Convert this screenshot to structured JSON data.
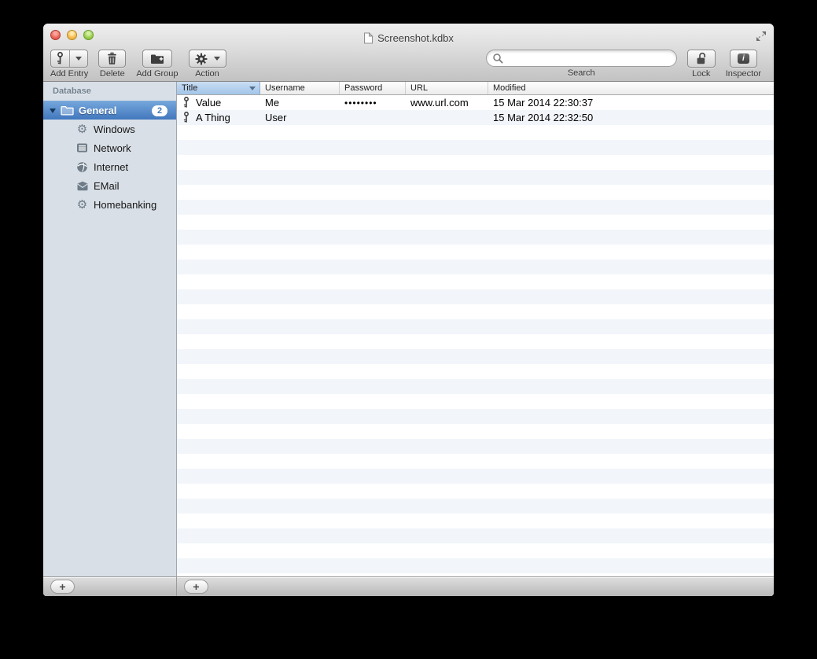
{
  "window": {
    "title": "Screenshot.kdbx"
  },
  "toolbar": {
    "add_entry_label": "Add Entry",
    "delete_label": "Delete",
    "add_group_label": "Add Group",
    "action_label": "Action",
    "search_label": "Search",
    "search_value": "",
    "lock_label": "Lock",
    "inspector_label": "Inspector"
  },
  "sidebar": {
    "header": "Database",
    "group": {
      "label": "General",
      "badge": "2"
    },
    "items": [
      {
        "label": "Windows",
        "icon": "gear-icon"
      },
      {
        "label": "Network",
        "icon": "server-icon"
      },
      {
        "label": "Internet",
        "icon": "globe-icon"
      },
      {
        "label": "EMail",
        "icon": "envelope-icon"
      },
      {
        "label": "Homebanking",
        "icon": "gear-icon"
      }
    ]
  },
  "table": {
    "columns": [
      {
        "label": "Title",
        "sorted": "desc"
      },
      {
        "label": "Username"
      },
      {
        "label": "Password"
      },
      {
        "label": "URL"
      },
      {
        "label": "Modified"
      }
    ],
    "rows": [
      {
        "title": "Value",
        "username": "Me",
        "password": "••••••••",
        "url": "www.url.com",
        "modified": "15 Mar 2014 22:30:37"
      },
      {
        "title": "A Thing",
        "username": "User",
        "password": "",
        "url": "",
        "modified": "15 Mar 2014 22:32:50"
      }
    ]
  },
  "bottom_bar": {
    "add_button": "+"
  },
  "colors": {
    "selection_blue_top": "#74a6db",
    "selection_blue_bottom": "#4177bd",
    "sorted_header_top": "#cadef3",
    "sorted_header_bottom": "#a2c5e9",
    "row_stripe": "#f2f5fa",
    "sidebar_bg": "#d8dfe6"
  }
}
